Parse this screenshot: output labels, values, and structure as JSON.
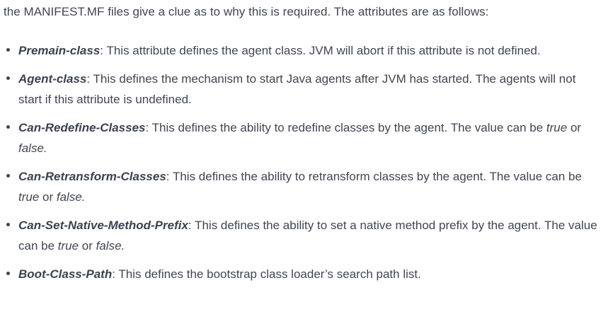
{
  "intro": "the MANIFEST.MF files give a clue as to why this is required. The attributes are as follows:",
  "attributes": [
    {
      "term": "Premain-class",
      "sep": ":",
      "text": " This attribute defines the agent class. JVM will abort if this attribute is not defined."
    },
    {
      "term": "Agent-class",
      "sep": ":",
      "text": " This defines the mechanism to start Java agents after JVM has started. The agents will not start if this attribute is undefined."
    },
    {
      "term": "Can-Redefine-Classes",
      "sep": ":",
      "text": " This defines the ability to redefine classes by the agent. The value can be ",
      "value_true": "true",
      "or": " or ",
      "value_false": "false",
      "end": "."
    },
    {
      "term": "Can-Retransform-Classes",
      "sep": ":",
      "text": " This defines the ability to retransform classes by the agent. The value can be ",
      "value_true": "true",
      "or": " or ",
      "value_false": "false",
      "end": "."
    },
    {
      "term": "Can-Set-Native-Method-Prefix",
      "sep": ":",
      "text": " This defines the ability to set a native method prefix by the agent. The value can be ",
      "value_true": "true",
      "or": " or ",
      "value_false": "false",
      "end": "."
    },
    {
      "term": "Boot-Class-Path",
      "sep": ":",
      "text": " This defines the bootstrap class loader’s search path list."
    }
  ]
}
